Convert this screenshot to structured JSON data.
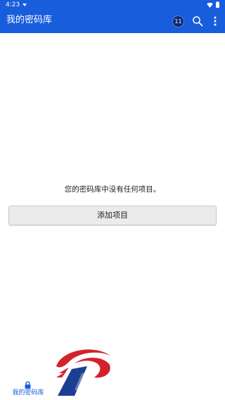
{
  "status_bar": {
    "time": "4:23"
  },
  "app_bar": {
    "title": "我的密码库",
    "account_initials": "11"
  },
  "main": {
    "empty_message": "您的密码库中没有任何项目。",
    "add_item_label": "添加项目"
  },
  "bottom_nav": {
    "items": [
      {
        "label": "我的密码库",
        "icon": "lock-icon",
        "selected": true
      }
    ]
  },
  "colors": {
    "brand": "#175ddc",
    "badge": "#0a2a7a",
    "watermark_red": "#d3232a",
    "watermark_blue": "#1c3f94"
  }
}
